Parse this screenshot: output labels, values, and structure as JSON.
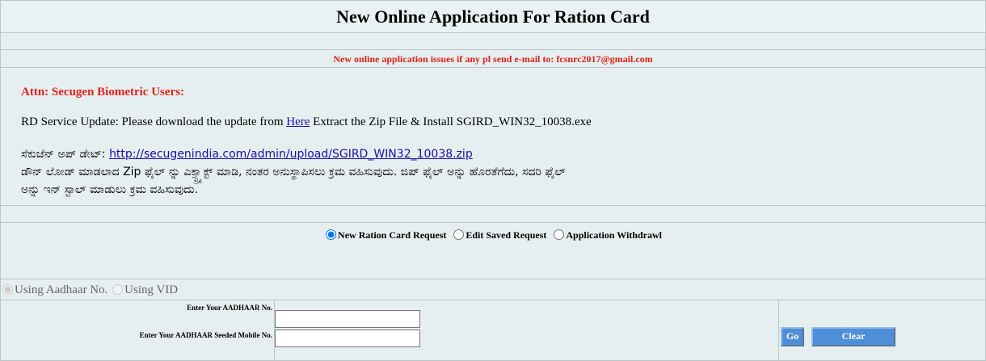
{
  "header": {
    "title": "New Online Application For Ration Card"
  },
  "notice": {
    "email_text": "New online application issues if any pl send e-mail to: fcsnrc2017@gmail.com"
  },
  "info": {
    "attn": "Attn: Secugen Biometric Users:",
    "rd_prefix": "RD Service Update: Please download the update from",
    "rd_link": "Here",
    "rd_suffix": "Extract the Zip File & Install SGIRD_WIN32_10038.exe",
    "kan_label": "ಸೆಕುಜೆನ್ ಅಪ್ ಡೇಟ್:",
    "kan_link": "http://secugenindia.com/admin/upload/SGIRD_WIN32_10038.zip",
    "kan_line2": "ಡೌನ್ ಲೋಡ್ ಮಾಡಲಾದ Zip ಫೈಲ್ ನ್ನು ಎಕ್ಸ್ಟ್ರ್ಯಾಕ್ಟ್ ಮಾಡಿ, ನಂತರ ಅನುಸ್ಥಾಪಿಸಲು ಕ್ರಮ ವಹಿಸುವುದು. ಜಿಪ್ ಫೈಲ್ ಅನ್ನು ಹೊರತೆಗೆದು, ಸದರಿ ಫೈಲ್",
    "kan_line3": "ಅನ್ನು ಇನ್ ಸ್ಟಾಲ್ ಮಾಡುಲು ಕ್ರಮ ವಹಿಸುವುದು."
  },
  "request_type": {
    "options": [
      {
        "label": "New Ration Card Request",
        "selected": true
      },
      {
        "label": "Edit Saved Request",
        "selected": false
      },
      {
        "label": "Application Withdrawl",
        "selected": false
      }
    ]
  },
  "id_mode": {
    "options": [
      {
        "label": "Using Aadhaar No.",
        "selected": true,
        "disabled": true
      },
      {
        "label": "Using VID",
        "selected": false,
        "disabled": true
      }
    ]
  },
  "form": {
    "aadhaar_label": "Enter Your AADHAAR No.",
    "mobile_label": "Enter Your AADHAAR Seeded Mobile No.",
    "aadhaar_value": "",
    "mobile_value": "",
    "go_label": "Go",
    "clear_label": "Clear"
  },
  "colors": {
    "accent_red": "#e0201a",
    "button_blue": "#4f8ed8",
    "panel_bg": "#e6efef"
  }
}
